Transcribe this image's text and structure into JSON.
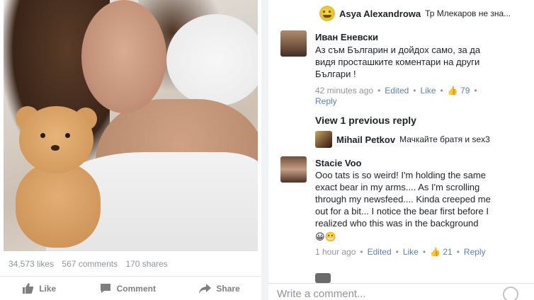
{
  "post": {
    "stats": {
      "likes": "34,573 likes",
      "comments": "567 comments",
      "shares": "170 shares"
    },
    "actions": {
      "like": "Like",
      "comment": "Comment",
      "share": "Share"
    }
  },
  "comments": {
    "top_reply": {
      "name": "Asya Alexandrowa",
      "text": "Тр Млекаров не зна..."
    },
    "ivan": {
      "name": "Иван Еневски",
      "line1": "Аз съм Българин и дойдох само, за да",
      "line2": "видя просташките коментари на други",
      "line3": "Българи !",
      "time": "42 minutes ago",
      "edited": "Edited",
      "like": "Like",
      "likes_count": "79",
      "reply": "Reply"
    },
    "view_previous": "View 1 previous reply",
    "mihail": {
      "name": "Mihail Petkov",
      "text": "Мачкайте братя и sex3"
    },
    "stacie": {
      "name": "Stacie Voo",
      "line1": "Ooo tats is so weird! I'm holding the same",
      "line2": "exact bear in my arms.... As I'm scrolling",
      "line3": "through my newsfeed.... Kinda creeped me",
      "line4": "out for a bit... I notice the bear first before I",
      "line5": "realized who this was in the background",
      "time": "1 hour ago",
      "edited": "Edited",
      "like": "Like",
      "likes_count": "21",
      "reply": "Reply"
    }
  },
  "composer": {
    "placeholder": "Write a comment..."
  },
  "colors": {
    "link": "#5d7fb5",
    "meta": "#90949c",
    "text": "#1d2129"
  }
}
